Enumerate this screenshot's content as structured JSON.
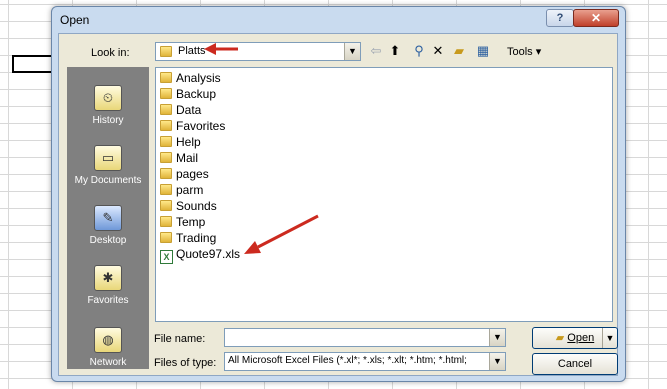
{
  "dialog": {
    "title": "Open",
    "help_glyph": "?",
    "close_glyph": "✕"
  },
  "lookin": {
    "label": "Look in:",
    "value": "Platts"
  },
  "toolbar": {
    "tools_label": "Tools"
  },
  "places": [
    {
      "label": "History",
      "icon": "history-icon"
    },
    {
      "label": "My Documents",
      "icon": "my-documents-icon"
    },
    {
      "label": "Desktop",
      "icon": "desktop-icon"
    },
    {
      "label": "Favorites",
      "icon": "favorites-icon"
    },
    {
      "label": "Network",
      "icon": "network-icon"
    }
  ],
  "files": [
    {
      "name": "Analysis",
      "type": "folder"
    },
    {
      "name": "Backup",
      "type": "folder"
    },
    {
      "name": "Data",
      "type": "folder"
    },
    {
      "name": "Favorites",
      "type": "folder"
    },
    {
      "name": "Help",
      "type": "folder"
    },
    {
      "name": "Mail",
      "type": "folder"
    },
    {
      "name": "pages",
      "type": "folder"
    },
    {
      "name": "parm",
      "type": "folder"
    },
    {
      "name": "Sounds",
      "type": "folder"
    },
    {
      "name": "Temp",
      "type": "folder"
    },
    {
      "name": "Trading",
      "type": "folder"
    },
    {
      "name": "Quote97.xls",
      "type": "xls"
    }
  ],
  "bottom": {
    "filename_label": "File name:",
    "filename_value": "",
    "filetype_label": "Files of type:",
    "filetype_value": "All Microsoft Excel Files (*.xl*; *.xls; *.xlt; *.htm; *.html;",
    "open_label": "Open",
    "cancel_label": "Cancel"
  },
  "colors": {
    "annotation_arrow": "#cc2a1f"
  }
}
